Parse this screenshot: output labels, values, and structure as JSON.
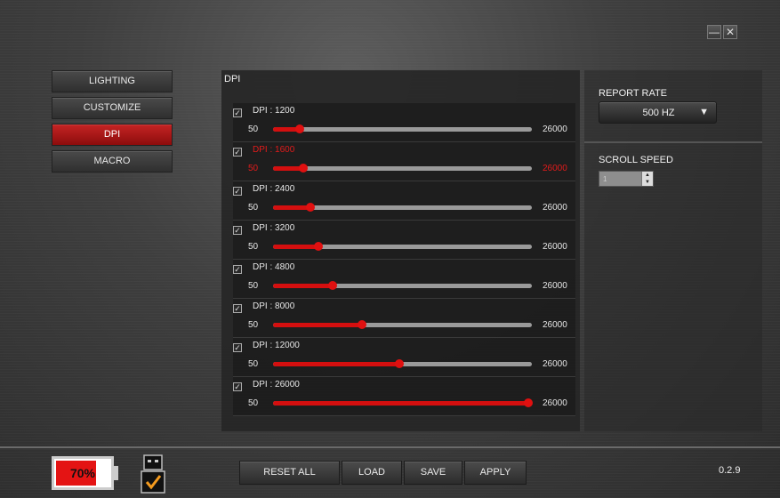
{
  "window": {
    "minimize_symbol": "—",
    "close_symbol": "✕"
  },
  "nav": {
    "items": [
      {
        "label": "LIGHTING",
        "active": false
      },
      {
        "label": "CUSTOMIZE",
        "active": false
      },
      {
        "label": "DPI",
        "active": true
      },
      {
        "label": "MACRO",
        "active": false
      }
    ]
  },
  "dpi_panel": {
    "title": "DPI",
    "levels": [
      {
        "label": "DPI : 1200",
        "min": "50",
        "max": "26000",
        "value": 1200,
        "checked": true,
        "selected": false
      },
      {
        "label": "DPI : 1600",
        "min": "50",
        "max": "26000",
        "value": 1600,
        "checked": true,
        "selected": true
      },
      {
        "label": "DPI : 2400",
        "min": "50",
        "max": "26000",
        "value": 2400,
        "checked": true,
        "selected": false
      },
      {
        "label": "DPI : 3200",
        "min": "50",
        "max": "26000",
        "value": 3200,
        "checked": true,
        "selected": false
      },
      {
        "label": "DPI : 4800",
        "min": "50",
        "max": "26000",
        "value": 4800,
        "checked": true,
        "selected": false
      },
      {
        "label": "DPI : 8000",
        "min": "50",
        "max": "26000",
        "value": 8000,
        "checked": true,
        "selected": false
      },
      {
        "label": "DPI : 12000",
        "min": "50",
        "max": "26000",
        "value": 12000,
        "checked": true,
        "selected": false
      },
      {
        "label": "DPI : 26000",
        "min": "50",
        "max": "26000",
        "value": 26000,
        "checked": true,
        "selected": false
      }
    ],
    "check_mark": "✓"
  },
  "report_rate": {
    "label": "REPORT RATE",
    "value": "500 HZ",
    "arrow": "▼"
  },
  "scroll_speed": {
    "label": "SCROLL SPEED",
    "value": "1",
    "up": "▲",
    "down": "▼"
  },
  "battery": {
    "percent_text": "70%",
    "level": 0.7,
    "fill_color": "#e41414"
  },
  "usb_icon": "usb-connected-check-icon",
  "actions": {
    "reset_all": "RESET ALL",
    "load": "LOAD",
    "save": "SAVE",
    "apply": "APPLY"
  },
  "version": "0.2.9",
  "colors": {
    "accent": "#d40f0f",
    "selected_text": "#e21b1b",
    "check_orange": "#f39a1e"
  }
}
